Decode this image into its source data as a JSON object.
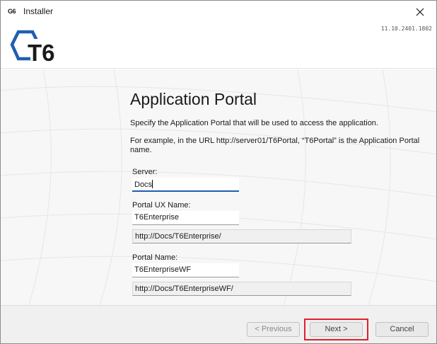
{
  "window": {
    "title": "Installer",
    "app_icon_text": "G6",
    "version": "11.10.2401.1802",
    "logo_text": "T6"
  },
  "page": {
    "title": "Application Portal",
    "description": "Specify the Application Portal that will be used to access the application.",
    "example": "For example, in the URL http://server01/T6Portal, “T6Portal” is the Application Portal name."
  },
  "form": {
    "server_label": "Server:",
    "server_value": "Docs",
    "portal_ux_label": "Portal UX Name:",
    "portal_ux_value": "T6Enterprise",
    "portal_ux_url": "http://Docs/T6Enterprise/",
    "portal_name_label": "Portal Name:",
    "portal_name_value": "T6EnterpriseWF",
    "portal_name_url": "http://Docs/T6EnterpriseWF/"
  },
  "buttons": {
    "previous": "< Previous",
    "next": "Next >",
    "cancel": "Cancel"
  },
  "colors": {
    "logo_blue": "#1f5fae",
    "highlight": "#e0202a"
  }
}
